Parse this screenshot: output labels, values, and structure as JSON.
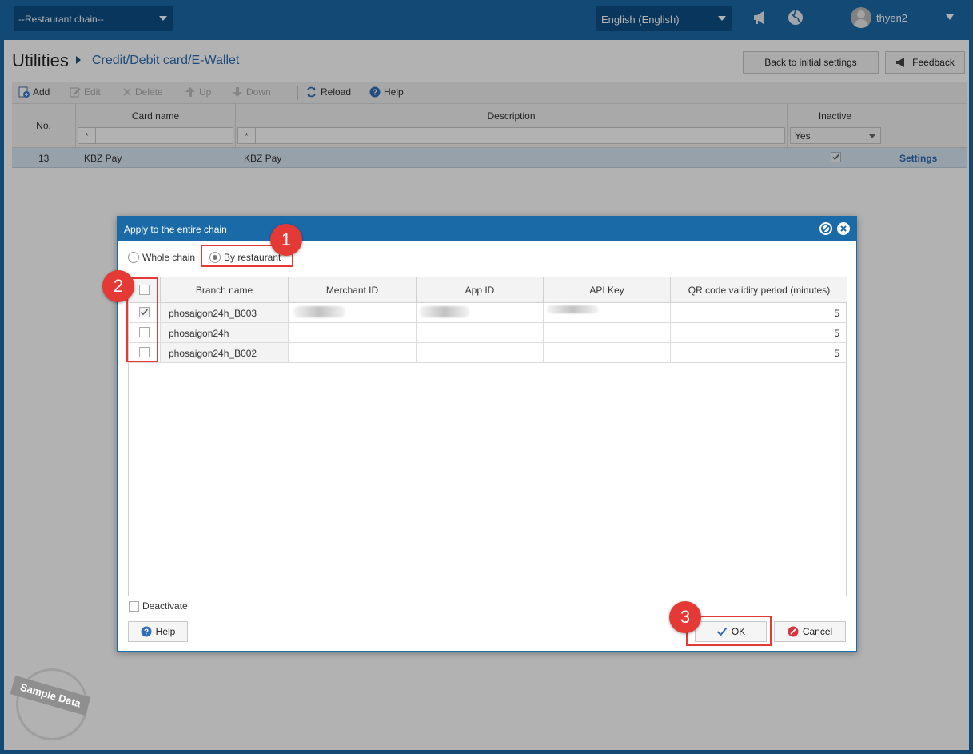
{
  "topbar": {
    "chain_select": "--Restaurant chain--",
    "language": "English (English)",
    "username": "thyen2"
  },
  "page": {
    "title": "Utilities",
    "breadcrumb": "Credit/Debit card/E-Wallet",
    "back_button": "Back to initial settings",
    "feedback_button": "Feedback"
  },
  "toolbar": {
    "add": "Add",
    "edit": "Edit",
    "delete": "Delete",
    "up": "Up",
    "down": "Down",
    "reload": "Reload",
    "help": "Help"
  },
  "grid": {
    "columns": {
      "no": "No.",
      "card_name": "Card name",
      "description": "Description",
      "inactive": "Inactive"
    },
    "filter_star": "*",
    "inactive_filter": "Yes",
    "row": {
      "no": "13",
      "card_name": "KBZ Pay",
      "description": "KBZ Pay",
      "inactive": true,
      "settings": "Settings"
    }
  },
  "dialog": {
    "title": "Apply to the entire chain",
    "radio_whole_chain": "Whole chain",
    "radio_by_restaurant": "By restaurant",
    "selected": "By restaurant",
    "columns": {
      "branch": "Branch name",
      "merchant": "Merchant ID",
      "app": "App ID",
      "api": "API Key",
      "qr": "QR code validity period (minutes)"
    },
    "rows": [
      {
        "branch": "phosaigon24h_B003",
        "checked": true,
        "qr": "5"
      },
      {
        "branch": "phosaigon24h",
        "checked": false,
        "qr": "5"
      },
      {
        "branch": "phosaigon24h_B002",
        "checked": false,
        "qr": "5"
      }
    ],
    "deactivate": "Deactivate",
    "help": "Help",
    "ok": "OK",
    "cancel": "Cancel"
  },
  "callouts": [
    "1",
    "2",
    "3"
  ],
  "watermark": "Sample Data",
  "colors": {
    "header_blue": "#1b6aa8",
    "callout_red": "#e53935",
    "selected_row": "#d9e7f4"
  }
}
